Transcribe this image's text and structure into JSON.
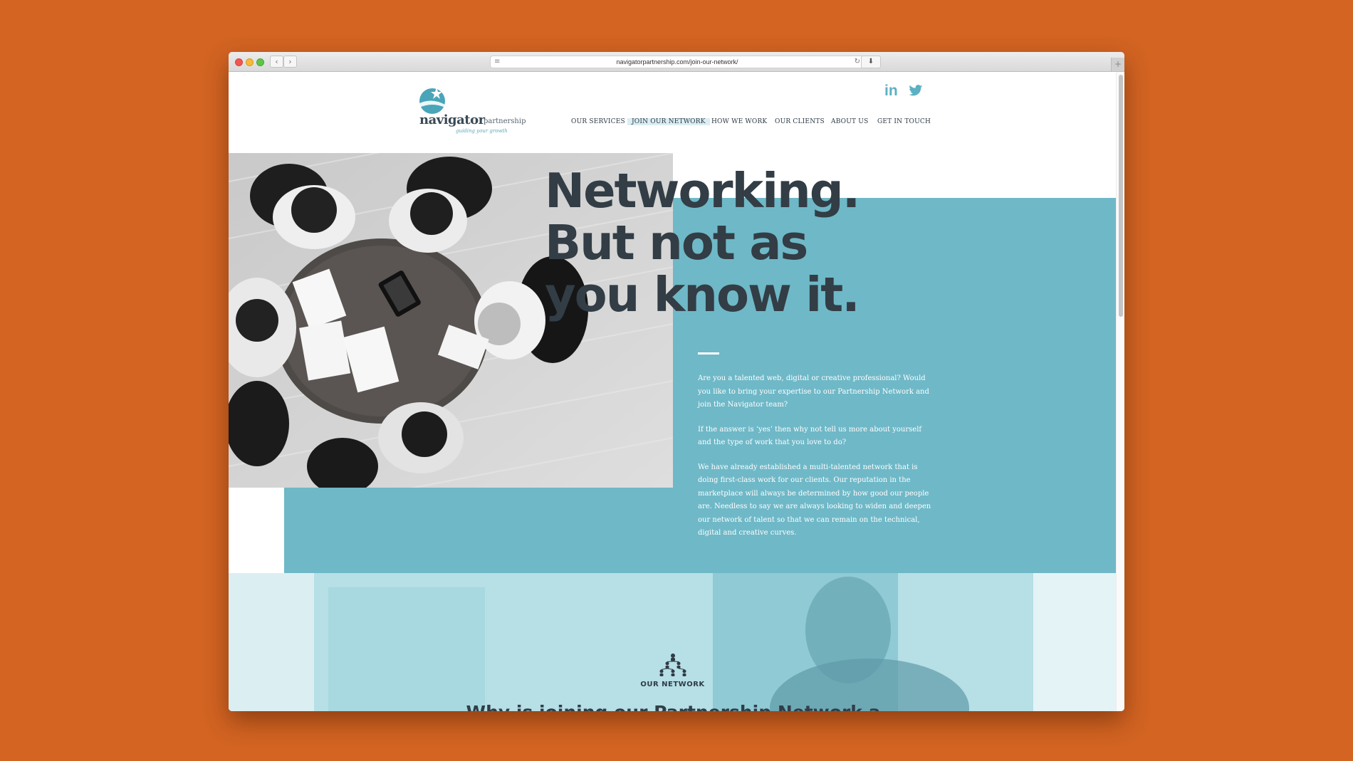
{
  "browser": {
    "url": "navigatorpartnership.com/join-our-network/",
    "back_glyph": "‹",
    "forward_glyph": "›",
    "reader_icon": "reader-icon",
    "reload_glyph": "↻",
    "download_glyph": "⬇",
    "new_tab_glyph": "+"
  },
  "brand": {
    "name": "navigator",
    "suffix": "partnership",
    "tagline": "guiding your growth",
    "colors": {
      "teal": "#6fb8c7",
      "dark": "#323d45",
      "background": "#d36422"
    }
  },
  "social": {
    "linkedin": "in",
    "twitter_icon": "twitter-icon"
  },
  "nav": {
    "items": [
      {
        "label": "OUR SERVICES"
      },
      {
        "label": "JOIN OUR NETWORK",
        "active": true
      },
      {
        "label": "HOW WE WORK"
      },
      {
        "label": "OUR CLIENTS"
      },
      {
        "label": "ABOUT US"
      },
      {
        "label": "GET IN TOUCH"
      }
    ]
  },
  "hero": {
    "title_lines": [
      "Networking.",
      "But not as",
      "you know it."
    ],
    "paragraphs": [
      "Are you a talented web, digital or creative professional? Would you like to bring your expertise to our Partnership Network and join the Navigator team?",
      "If the answer is ‘yes’ then why not tell us more about yourself and the type of work that you love to do?",
      "We have already established a multi-talented network that is doing first-class work for our clients. Our reputation in the marketplace will always be determined by how good our people are. Needless to say we are always looking to widen and deepen our network of talent so that we can remain on the technical, digital and creative curves."
    ]
  },
  "network_section": {
    "label": "OUR NETWORK",
    "heading": "Why is joining our Partnership Network a good idea?"
  }
}
